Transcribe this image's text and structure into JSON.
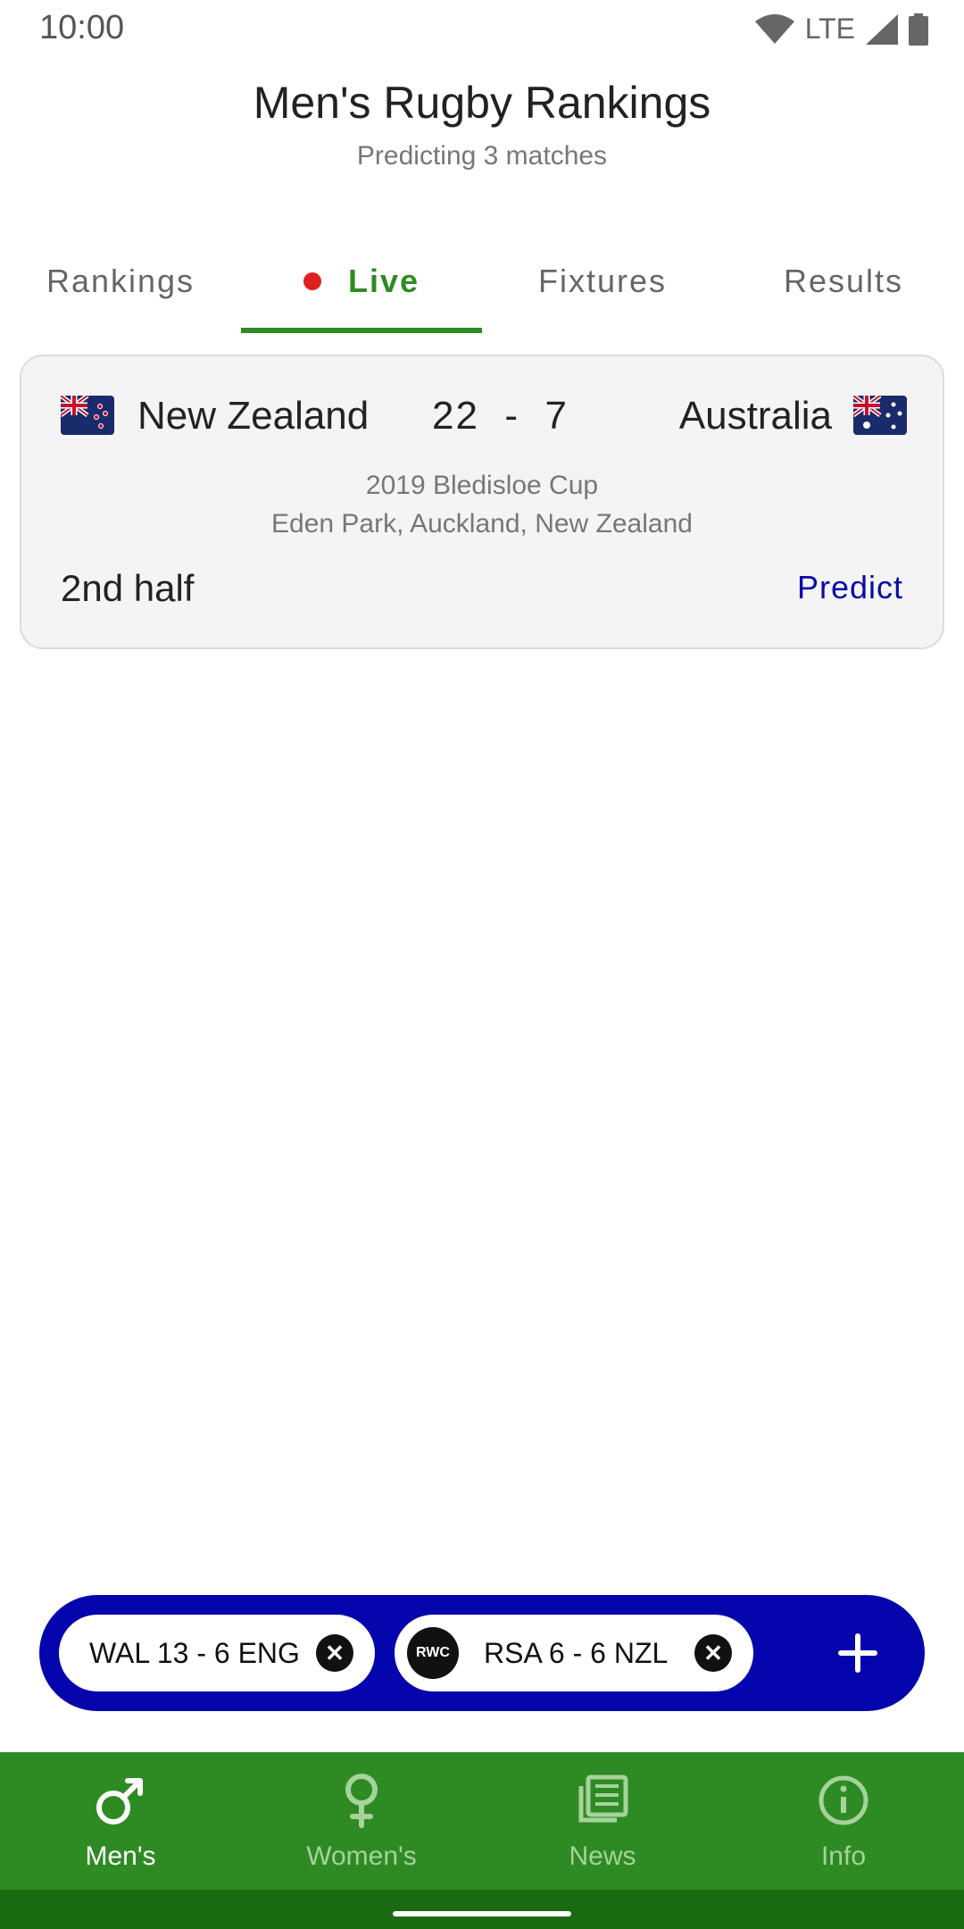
{
  "status_bar": {
    "time": "10:00",
    "network": "LTE"
  },
  "header": {
    "title": "Men's Rugby Rankings",
    "subtitle": "Predicting 3 matches"
  },
  "tabs": [
    {
      "label": "Rankings"
    },
    {
      "label": "Live",
      "active": true
    },
    {
      "label": "Fixtures"
    },
    {
      "label": "Results"
    }
  ],
  "match": {
    "home_team": "New Zealand",
    "home_flag": "new-zealand-flag-icon",
    "score": "22  -  7",
    "away_team": "Australia",
    "away_flag": "australia-flag-icon",
    "competition": "2019 Bledisloe Cup",
    "venue": "Eden Park, Auckland, New Zealand",
    "status": "2nd half",
    "predict_label": "Predict"
  },
  "ticker": {
    "chips": [
      {
        "label": "WAL 13 - 6 ENG"
      },
      {
        "label": "RSA 6 - 6 NZL",
        "logo": "RWC"
      }
    ]
  },
  "bottom_nav": [
    {
      "label": "Men's",
      "icon": "male-icon",
      "active": true
    },
    {
      "label": "Women's",
      "icon": "female-icon"
    },
    {
      "label": "News",
      "icon": "news-icon"
    },
    {
      "label": "Info",
      "icon": "info-icon"
    }
  ],
  "colors": {
    "primary_green": "#2e8b23",
    "live_red": "#e02020",
    "ticker_blue": "#0505ad",
    "predict_blue": "#0a0aa8"
  }
}
